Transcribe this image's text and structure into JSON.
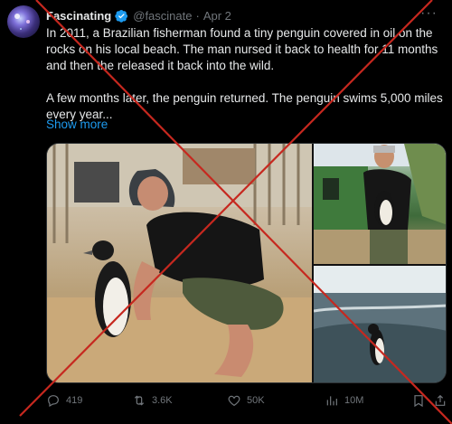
{
  "post": {
    "author_name": "Fascinating",
    "author_handle": "@fascinate",
    "date": "Apr 2",
    "separator": "·",
    "more_glyph": "···",
    "paragraph_1": "In 2011, a Brazilian fisherman found a tiny penguin covered in oil on the rocks on his local beach. The man nursed it back to health for 11 months and then the released it back into the wild.",
    "paragraph_2": "A few months later, the penguin returned. The penguin swims 5,000 miles every year...",
    "show_more": "Show more"
  },
  "actions": {
    "replies": "419",
    "reposts": "3.6K",
    "likes": "50K",
    "views": "10M"
  },
  "colors": {
    "background": "#000000",
    "text": "#e7e9ea",
    "muted": "#71767b",
    "link": "#1d9bf0",
    "verified": "#1d9bf0",
    "cross": "#c6281f"
  },
  "icons": [
    "verified-badge-icon",
    "more-icon",
    "reply-icon",
    "repost-icon",
    "like-icon",
    "views-icon",
    "bookmark-icon",
    "share-icon"
  ]
}
